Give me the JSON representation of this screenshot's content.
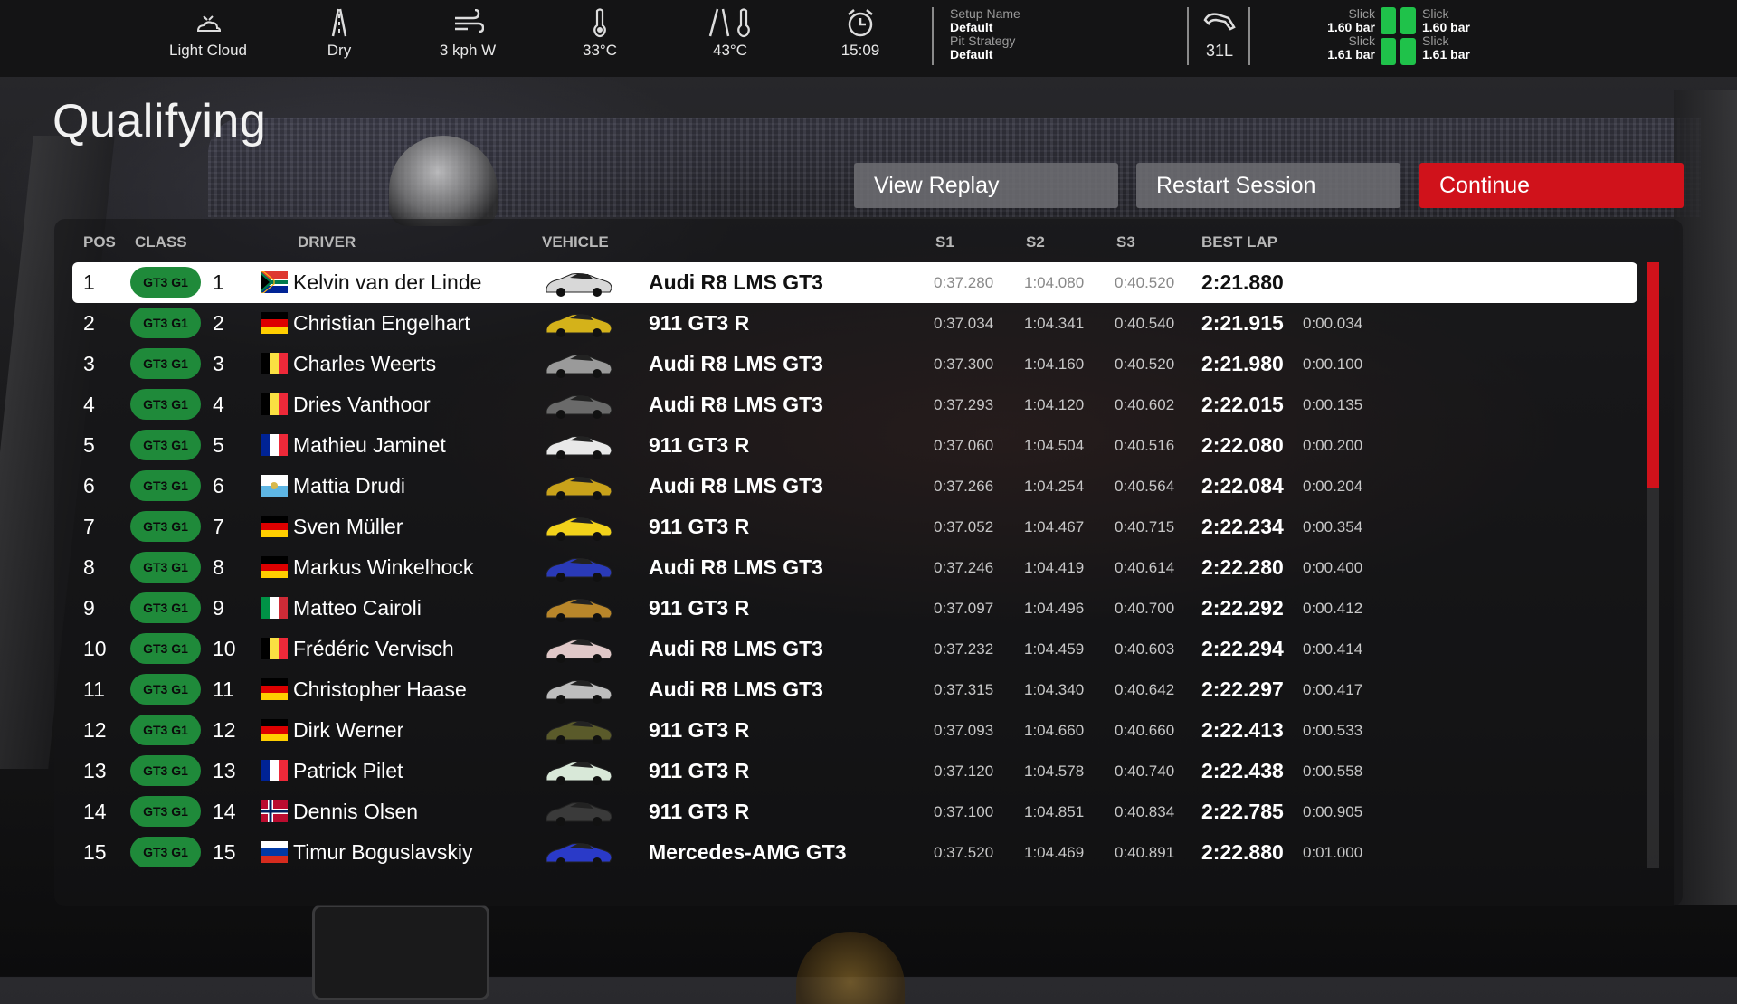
{
  "hud": {
    "weather": "Light Cloud",
    "track_condition": "Dry",
    "wind": "3 kph  W",
    "air_temp": "33°C",
    "track_temp": "43°C",
    "time": "15:09",
    "setup_name_label": "Setup Name",
    "setup_name_value": "Default",
    "pit_strategy_label": "Pit Strategy",
    "pit_strategy_value": "Default",
    "fuel": "31L",
    "tyres": {
      "fl_compound": "Slick",
      "fl_pressure": "1.60 bar",
      "fr_compound": "Slick",
      "fr_pressure": "1.60 bar",
      "rl_compound": "Slick",
      "rl_pressure": "1.61 bar",
      "rr_compound": "Slick",
      "rr_pressure": "1.61 bar"
    }
  },
  "title": "Qualifying",
  "buttons": {
    "view_replay": "View Replay",
    "restart_session": "Restart Session",
    "continue": "Continue"
  },
  "colors": {
    "accent_red": "#d0121b",
    "class_badge_green": "#1f8a3a",
    "tyre_green": "#1fc24a"
  },
  "table": {
    "headers": {
      "pos": "POS",
      "class": "CLASS",
      "driver": "DRIVER",
      "vehicle": "VEHICLE",
      "s1": "S1",
      "s2": "S2",
      "s3": "S3",
      "best_lap": "BEST LAP"
    },
    "rows": [
      {
        "pos": "1",
        "class": "GT3 G1",
        "class_pos": "1",
        "flag": "ZA",
        "driver": "Kelvin van der Linde",
        "vehicle": "Audi R8 LMS GT3",
        "s1": "0:37.280",
        "s2": "1:04.080",
        "s3": "0:40.520",
        "best": "2:21.880",
        "gap": "",
        "car_color": "#d8d8d8"
      },
      {
        "pos": "2",
        "class": "GT3 G1",
        "class_pos": "2",
        "flag": "DE",
        "driver": "Christian Engelhart",
        "vehicle": "911 GT3 R",
        "s1": "0:37.034",
        "s2": "1:04.341",
        "s3": "0:40.540",
        "best": "2:21.915",
        "gap": "0:00.034",
        "car_color": "#d4b21a"
      },
      {
        "pos": "3",
        "class": "GT3 G1",
        "class_pos": "3",
        "flag": "BE",
        "driver": "Charles Weerts",
        "vehicle": "Audi R8 LMS GT3",
        "s1": "0:37.300",
        "s2": "1:04.160",
        "s3": "0:40.520",
        "best": "2:21.980",
        "gap": "0:00.100",
        "car_color": "#9a9a9a"
      },
      {
        "pos": "4",
        "class": "GT3 G1",
        "class_pos": "4",
        "flag": "BE",
        "driver": "Dries Vanthoor",
        "vehicle": "Audi R8 LMS GT3",
        "s1": "0:37.293",
        "s2": "1:04.120",
        "s3": "0:40.602",
        "best": "2:22.015",
        "gap": "0:00.135",
        "car_color": "#6a6a6a"
      },
      {
        "pos": "5",
        "class": "GT3 G1",
        "class_pos": "5",
        "flag": "FR",
        "driver": "Mathieu Jaminet",
        "vehicle": "911 GT3 R",
        "s1": "0:37.060",
        "s2": "1:04.504",
        "s3": "0:40.516",
        "best": "2:22.080",
        "gap": "0:00.200",
        "car_color": "#e8e8e8"
      },
      {
        "pos": "6",
        "class": "GT3 G1",
        "class_pos": "6",
        "flag": "SM",
        "driver": "Mattia Drudi",
        "vehicle": "Audi R8 LMS GT3",
        "s1": "0:37.266",
        "s2": "1:04.254",
        "s3": "0:40.564",
        "best": "2:22.084",
        "gap": "0:00.204",
        "car_color": "#c9a21a"
      },
      {
        "pos": "7",
        "class": "GT3 G1",
        "class_pos": "7",
        "flag": "DE",
        "driver": "Sven Müller",
        "vehicle": "911 GT3 R",
        "s1": "0:37.052",
        "s2": "1:04.467",
        "s3": "0:40.715",
        "best": "2:22.234",
        "gap": "0:00.354",
        "car_color": "#f2d21a"
      },
      {
        "pos": "8",
        "class": "GT3 G1",
        "class_pos": "8",
        "flag": "DE",
        "driver": "Markus Winkelhock",
        "vehicle": "Audi R8 LMS GT3",
        "s1": "0:37.246",
        "s2": "1:04.419",
        "s3": "0:40.614",
        "best": "2:22.280",
        "gap": "0:00.400",
        "car_color": "#2a3ab8"
      },
      {
        "pos": "9",
        "class": "GT3 G1",
        "class_pos": "9",
        "flag": "IT",
        "driver": "Matteo Cairoli",
        "vehicle": "911 GT3 R",
        "s1": "0:37.097",
        "s2": "1:04.496",
        "s3": "0:40.700",
        "best": "2:22.292",
        "gap": "0:00.412",
        "car_color": "#b8862a"
      },
      {
        "pos": "10",
        "class": "GT3 G1",
        "class_pos": "10",
        "flag": "BE",
        "driver": "Frédéric Vervisch",
        "vehicle": "Audi R8 LMS GT3",
        "s1": "0:37.232",
        "s2": "1:04.459",
        "s3": "0:40.603",
        "best": "2:22.294",
        "gap": "0:00.414",
        "car_color": "#e0c8c8"
      },
      {
        "pos": "11",
        "class": "GT3 G1",
        "class_pos": "11",
        "flag": "DE",
        "driver": "Christopher Haase",
        "vehicle": "Audi R8 LMS GT3",
        "s1": "0:37.315",
        "s2": "1:04.340",
        "s3": "0:40.642",
        "best": "2:22.297",
        "gap": "0:00.417",
        "car_color": "#bdbdbd"
      },
      {
        "pos": "12",
        "class": "GT3 G1",
        "class_pos": "12",
        "flag": "DE",
        "driver": "Dirk Werner",
        "vehicle": "911 GT3 R",
        "s1": "0:37.093",
        "s2": "1:04.660",
        "s3": "0:40.660",
        "best": "2:22.413",
        "gap": "0:00.533",
        "car_color": "#5a5a2a"
      },
      {
        "pos": "13",
        "class": "GT3 G1",
        "class_pos": "13",
        "flag": "FR",
        "driver": "Patrick Pilet",
        "vehicle": "911 GT3 R",
        "s1": "0:37.120",
        "s2": "1:04.578",
        "s3": "0:40.740",
        "best": "2:22.438",
        "gap": "0:00.558",
        "car_color": "#d8e8d8"
      },
      {
        "pos": "14",
        "class": "GT3 G1",
        "class_pos": "14",
        "flag": "NO",
        "driver": "Dennis Olsen",
        "vehicle": "911 GT3 R",
        "s1": "0:37.100",
        "s2": "1:04.851",
        "s3": "0:40.834",
        "best": "2:22.785",
        "gap": "0:00.905",
        "car_color": "#3a3a3a"
      },
      {
        "pos": "15",
        "class": "GT3 G1",
        "class_pos": "15",
        "flag": "RU",
        "driver": "Timur Boguslavskiy",
        "vehicle": "Mercedes-AMG GT3",
        "s1": "0:37.520",
        "s2": "1:04.469",
        "s3": "0:40.891",
        "best": "2:22.880",
        "gap": "0:01.000",
        "car_color": "#2a3ac8"
      }
    ]
  }
}
